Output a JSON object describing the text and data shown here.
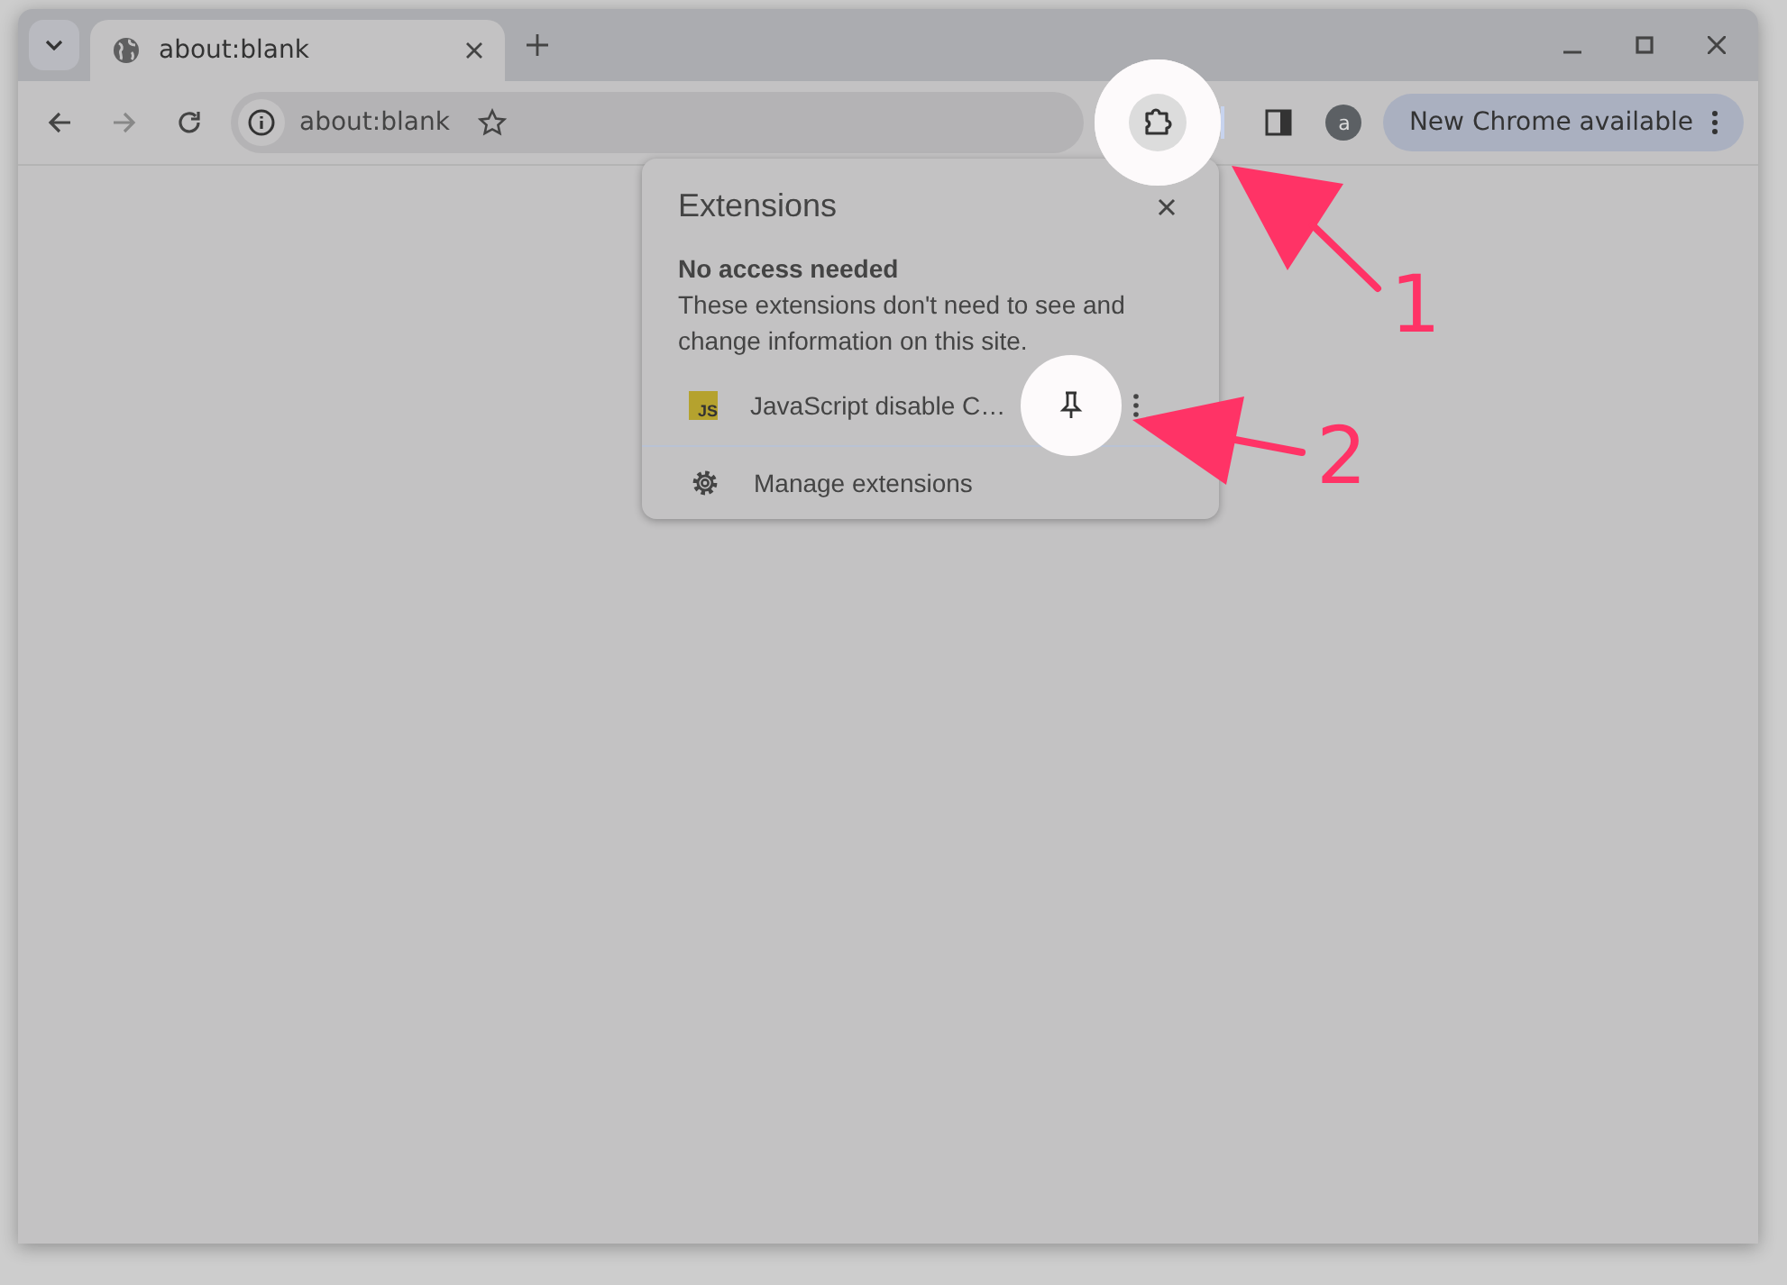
{
  "tabs": [
    {
      "title": "about:blank",
      "selected": true
    }
  ],
  "toolbar": {
    "address": "about:blank",
    "update_button": "New Chrome available",
    "avatar": "a"
  },
  "extensions_popup": {
    "title": "Extensions",
    "section_title": "No access needed",
    "section_text": "These extensions don't need to see and change information on this site.",
    "extensions": [
      {
        "name": "JavaScript disable C…",
        "badge": "JS",
        "pinned": false
      }
    ],
    "manage_label": "Manage extensions"
  },
  "annotations": [
    {
      "label": "1"
    },
    {
      "label": "2"
    }
  ]
}
